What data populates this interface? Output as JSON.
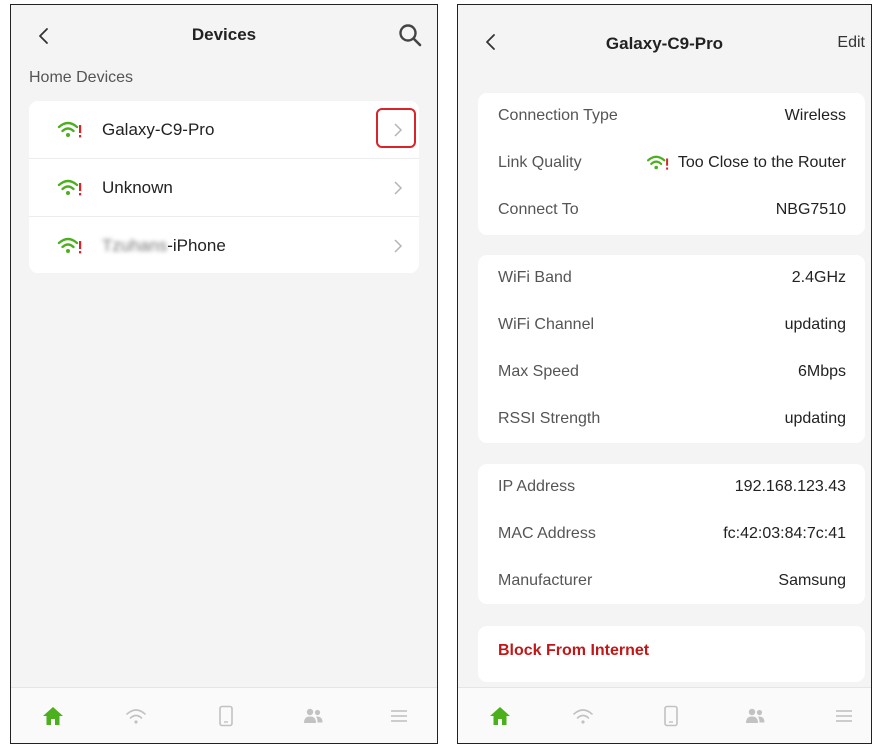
{
  "colors": {
    "accent_green": "#4caf1e",
    "alert_red": "#c01818",
    "highlight_red": "#d9252a",
    "inactive_icon": "#c2c2c2"
  },
  "left_screen": {
    "title": "Devices",
    "section_heading": "Home Devices",
    "devices": [
      {
        "name": "Galaxy-C9-Pro",
        "icon": "wifi-warning-icon",
        "highlighted": true
      },
      {
        "name": "Unknown",
        "icon": "wifi-warning-icon",
        "highlighted": false
      },
      {
        "name_blurred": "Tzuhans",
        "name": "-iPhone",
        "icon": "wifi-warning-icon",
        "highlighted": false
      }
    ]
  },
  "right_screen": {
    "title": "Galaxy-C9-Pro",
    "edit_label": "Edit",
    "connection": [
      {
        "label": "Connection Type",
        "value": "Wireless"
      },
      {
        "label": "Link Quality",
        "value": "Too Close to the Router"
      },
      {
        "label": "Connect To",
        "value": "NBG7510"
      }
    ],
    "wifi": [
      {
        "label": "WiFi Band",
        "value": "2.4GHz"
      },
      {
        "label": "WiFi Channel",
        "value": "updating"
      },
      {
        "label": "Max Speed",
        "value": "6Mbps"
      },
      {
        "label": "RSSI Strength",
        "value": "updating"
      }
    ],
    "network": [
      {
        "label": "IP Address",
        "value": "192.168.123.43"
      },
      {
        "label": "MAC Address",
        "value": "fc:42:03:84:7c:41"
      },
      {
        "label": "Manufacturer",
        "value": "Samsung"
      }
    ],
    "block_label": "Block From Internet"
  },
  "bottom_nav": [
    {
      "icon": "home-icon",
      "active": true
    },
    {
      "icon": "wifi-icon",
      "active": false
    },
    {
      "icon": "phone-device-icon",
      "active": false
    },
    {
      "icon": "users-icon",
      "active": false
    },
    {
      "icon": "menu-icon",
      "active": false
    }
  ]
}
